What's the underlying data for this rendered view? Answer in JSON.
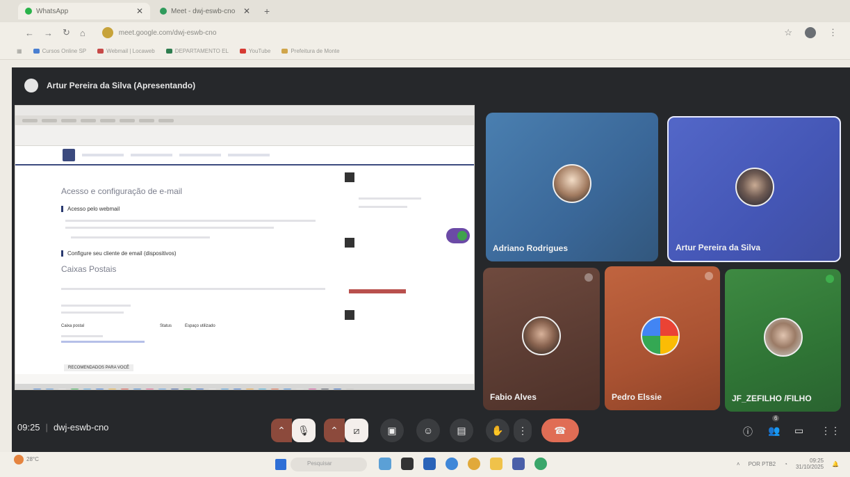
{
  "browser": {
    "tabs": [
      {
        "label": "WhatsApp",
        "favicon_color": "#29b34a"
      },
      {
        "label": "Meet - dwj-eswb-cno",
        "favicon_color": "#2f9b5c"
      }
    ],
    "address": "meet.google.com/dwj-eswb-cno",
    "bookmarks": [
      {
        "label": "Cursos Online SP",
        "color": "#4a7fd1"
      },
      {
        "label": "Webmail | Locaweb",
        "color": "#c74a48"
      },
      {
        "label": "DEPARTAMENTO EL",
        "color": "#2e7d4f"
      },
      {
        "label": "YouTube",
        "color": "#d63a32"
      },
      {
        "label": "Prefeitura de Monte",
        "color": "#d0a54a"
      }
    ]
  },
  "meet": {
    "presenter_label": "Artur Pereira da Silva (Apresentando)",
    "shared_screen": {
      "heading_access": "Acesso e configuração de e-mail",
      "section_webmail": "Acesso pelo webmail",
      "section_config": "Configure seu cliente de email (dispositivos)",
      "heading_mailboxes": "Caixas Postais",
      "col_mailbox": "Caixa postal",
      "col_status": "Status",
      "col_space": "Espaço utilizado",
      "recommended": "RECOMENDADOS PARA VOCÊ"
    },
    "participants": [
      {
        "name": "Adriano Rodrigues"
      },
      {
        "name": "Artur Pereira da Silva"
      },
      {
        "name": "Fabio Alves"
      },
      {
        "name": "Pedro Elssie"
      },
      {
        "name": "JF_ZEFILHO /FILHO"
      }
    ],
    "time": "09:25",
    "meeting_code": "dwj-eswb-cno",
    "participant_count": "6"
  },
  "taskbar": {
    "weather": "28°C",
    "search_placeholder": "Pesquisar",
    "language": "POR PTB2",
    "clock_time": "09:25",
    "clock_date": "31/10/2025"
  }
}
